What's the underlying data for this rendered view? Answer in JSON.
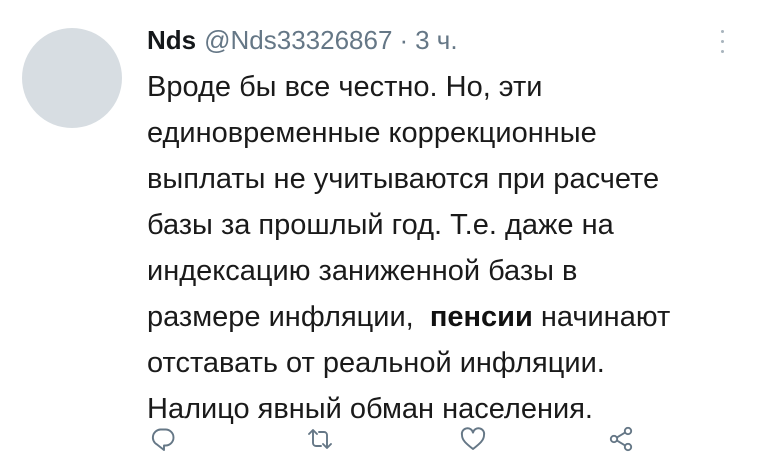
{
  "tweet": {
    "author_name": "Nds",
    "author_handle": "@Nds33326867",
    "separator": "·",
    "time": "3 ч.",
    "text_lines": [
      {
        "before": "Вроде бы все честно. Но, эти",
        "bold": "",
        "after": ""
      },
      {
        "before": "единовременные коррекционные",
        "bold": "",
        "after": ""
      },
      {
        "before": "выплаты не учитываются при расчете",
        "bold": "",
        "after": ""
      },
      {
        "before": "базы за прошлый год. Т.е. даже на",
        "bold": "",
        "after": ""
      },
      {
        "before": "индексацию заниженной базы в",
        "bold": "",
        "after": ""
      },
      {
        "before": "размере инфляции,  ",
        "bold": "пенсии",
        "after": " начинают"
      },
      {
        "before": "отставать от реальной инфляции.",
        "bold": "",
        "after": ""
      },
      {
        "before": "Налицо явный обман населения.",
        "bold": "",
        "after": ""
      }
    ]
  },
  "actions": {
    "reply_icon": "reply-icon",
    "retweet_icon": "retweet-icon",
    "like_icon": "like-icon",
    "share_icon": "share-icon"
  },
  "colors": {
    "secondary_text": "#657786",
    "avatar_placeholder": "#d7dde2",
    "icon": "#657786"
  }
}
